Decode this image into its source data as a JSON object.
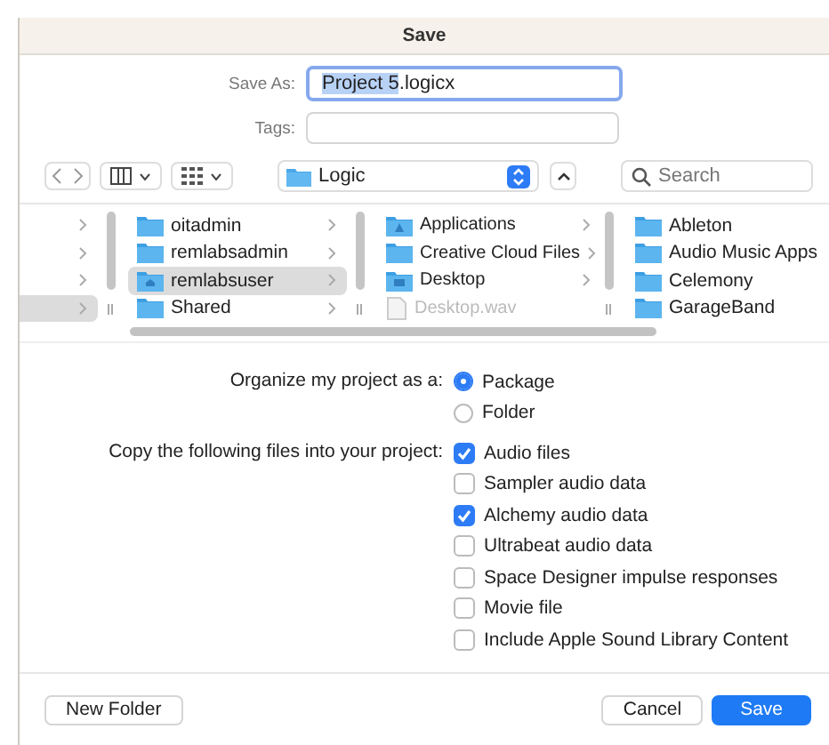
{
  "window": {
    "title": "Save"
  },
  "save_as": {
    "label": "Save As:",
    "value_selected": "Project 5",
    "value_rest": ".logicx"
  },
  "tags": {
    "label": "Tags:"
  },
  "location": {
    "value": "Logic"
  },
  "search": {
    "placeholder": "Search"
  },
  "browser": {
    "columns": [
      {
        "items": [
          {
            "selected": false
          },
          {
            "selected": false
          },
          {
            "selected": false
          },
          {
            "selected": true
          }
        ]
      },
      {
        "items": [
          {
            "name": "oitadmin",
            "kind": "folder",
            "selected": false,
            "disabled": false,
            "has_children": true
          },
          {
            "name": "remlabsadmin",
            "kind": "folder",
            "selected": false,
            "disabled": false,
            "has_children": true
          },
          {
            "name": "remlabsuser",
            "kind": "home",
            "selected": true,
            "disabled": false,
            "has_children": true
          },
          {
            "name": "Shared",
            "kind": "folder",
            "selected": false,
            "disabled": false,
            "has_children": true
          }
        ]
      },
      {
        "items": [
          {
            "name": "Applications",
            "kind": "apps",
            "selected": false,
            "disabled": false,
            "has_children": true
          },
          {
            "name": "Creative Cloud Files",
            "kind": "folder",
            "selected": false,
            "disabled": false,
            "has_children": true
          },
          {
            "name": "Desktop",
            "kind": "desktop",
            "selected": false,
            "disabled": false,
            "has_children": true
          },
          {
            "name": "Desktop.wav",
            "kind": "file",
            "selected": false,
            "disabled": true,
            "has_children": false
          }
        ]
      },
      {
        "items": [
          {
            "name": "Ableton",
            "kind": "folder",
            "selected": false,
            "disabled": false
          },
          {
            "name": "Audio Music Apps",
            "kind": "folder",
            "selected": false,
            "disabled": false
          },
          {
            "name": "Celemony",
            "kind": "folder",
            "selected": false,
            "disabled": false
          },
          {
            "name": "GarageBand",
            "kind": "folder",
            "selected": false,
            "disabled": false
          }
        ]
      }
    ]
  },
  "organize": {
    "label": "Organize my project as a:",
    "options": [
      {
        "label": "Package",
        "selected": true
      },
      {
        "label": "Folder",
        "selected": false
      }
    ]
  },
  "copy": {
    "label": "Copy the following files into your project:",
    "options": [
      {
        "label": "Audio files",
        "checked": true
      },
      {
        "label": "Sampler audio data",
        "checked": false
      },
      {
        "label": "Alchemy audio data",
        "checked": true
      },
      {
        "label": "Ultrabeat audio data",
        "checked": false
      },
      {
        "label": "Space Designer impulse responses",
        "checked": false
      },
      {
        "label": "Movie file",
        "checked": false
      },
      {
        "label": "Include Apple Sound Library Content",
        "checked": false
      }
    ]
  },
  "buttons": {
    "new_folder": "New Folder",
    "cancel": "Cancel",
    "save": "Save"
  }
}
